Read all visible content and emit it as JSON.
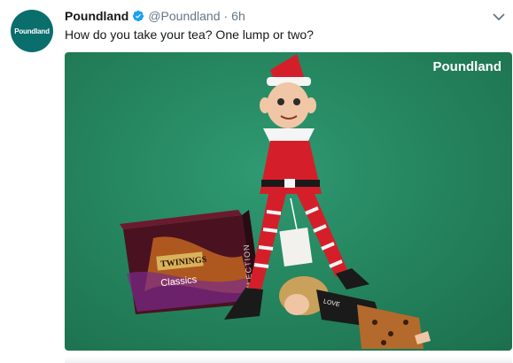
{
  "tweet": {
    "avatar_text": "Poundland",
    "name": "Poundland",
    "handle": "@Poundland",
    "separator": "·",
    "time": "6h",
    "text": "How do you take your tea? One lump or two?",
    "verified_icon": "verified-badge-icon",
    "menu_icon": "chevron-down-icon",
    "accent_color": "#1da1f2"
  },
  "photo": {
    "watermark": "Poundland",
    "box_brand": "TWININGS",
    "box_label": "Classics",
    "box_side": "SELECTION",
    "doll_shirt": "LOVE"
  }
}
